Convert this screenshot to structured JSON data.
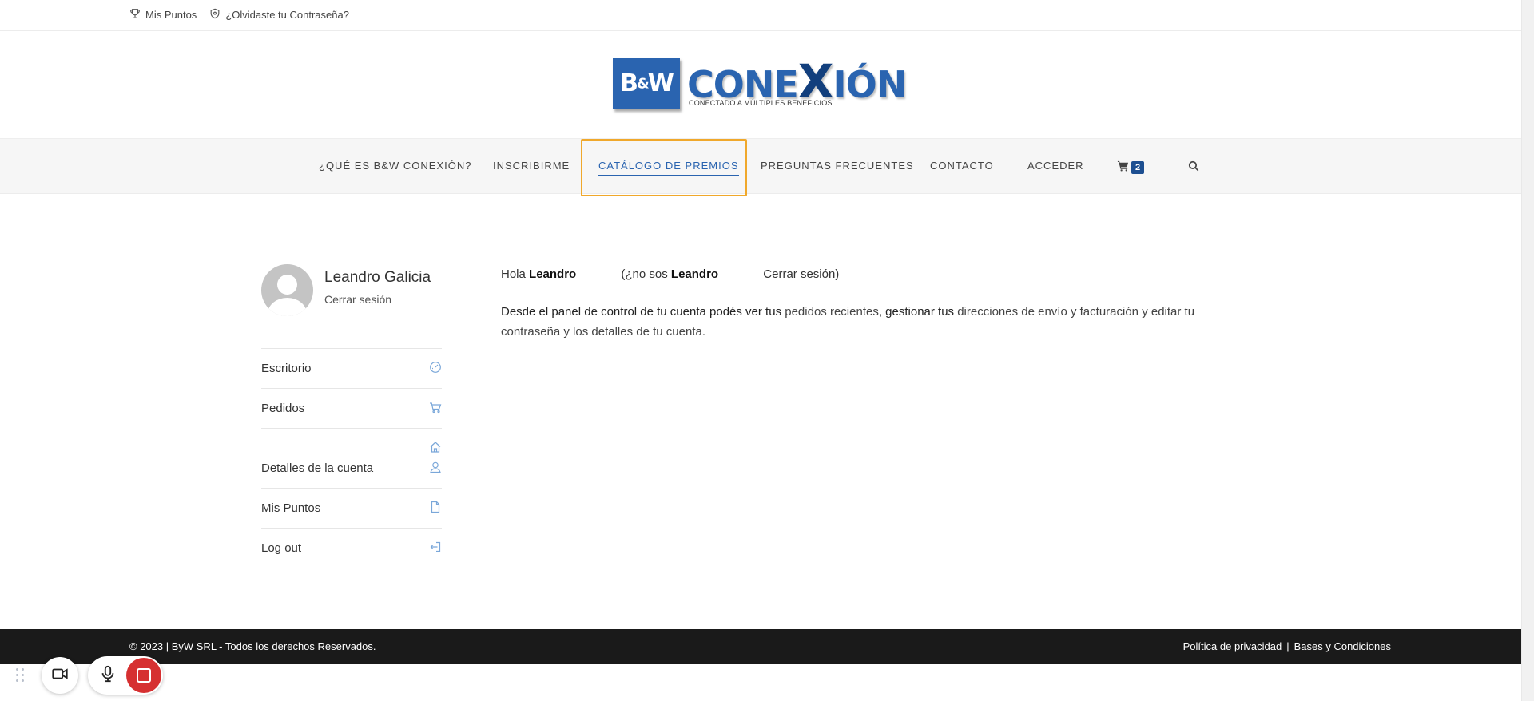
{
  "topbar": {
    "points_link": "Mis Puntos",
    "forgot_link": "¿Olvidaste tu Contraseña?"
  },
  "logo": {
    "mark_b": "B",
    "mark_amp": "&",
    "mark_w": "W",
    "word_a": "CONE",
    "word_x": "X",
    "word_b": "IÓN",
    "tagline": "CONECTADO A MÚLTIPLES BENEFICIOS"
  },
  "nav": {
    "items": [
      {
        "label": "¿QUÉ ES B&W CONEXIÓN?"
      },
      {
        "label": "INSCRIBIRME"
      },
      {
        "label": "CATÁLOGO DE PREMIOS"
      },
      {
        "label": "PREGUNTAS FRECUENTES"
      },
      {
        "label": "CONTACTO"
      },
      {
        "label": "ACCEDER"
      }
    ],
    "cart_count": "2",
    "accent": "#2a64b0",
    "highlight_color": "#f0a82b"
  },
  "account": {
    "user_name": "Leandro Galicia",
    "logout_label": "Cerrar sesión",
    "menu": [
      {
        "label": "Escritorio",
        "icon": "dashboard-gauge-icon"
      },
      {
        "label": "Pedidos",
        "icon": "basket-icon"
      },
      {
        "label": "Detalles de la cuenta",
        "icon": "user-icon"
      },
      {
        "label": "Mis Puntos",
        "icon": "document-icon"
      },
      {
        "label": "Log out",
        "icon": "logout-icon"
      }
    ]
  },
  "content": {
    "hello_prefix": "Hola",
    "hello_name": "Leandro",
    "hello_question": "(¿no sos",
    "hello_name2": "Leandro",
    "hello_logout": "Cerrar sesión)",
    "desc_1": "Desde el panel de control de tu cuenta podés ver tus",
    "desc_link_orders": "pedidos recientes",
    "desc_2": ", gestionar tus",
    "desc_link_addresses": "direcciones de envío y facturación",
    "desc_3": "y editar tu",
    "desc_link_password": "contraseña y los detalles de tu cuenta",
    "desc_4": "."
  },
  "footer": {
    "copyright": "© 2023 | ByW SRL - Todos los derechos Reservados.",
    "privacy": "Política de privacidad",
    "separator": "|",
    "terms": "Bases y Condiciones"
  }
}
